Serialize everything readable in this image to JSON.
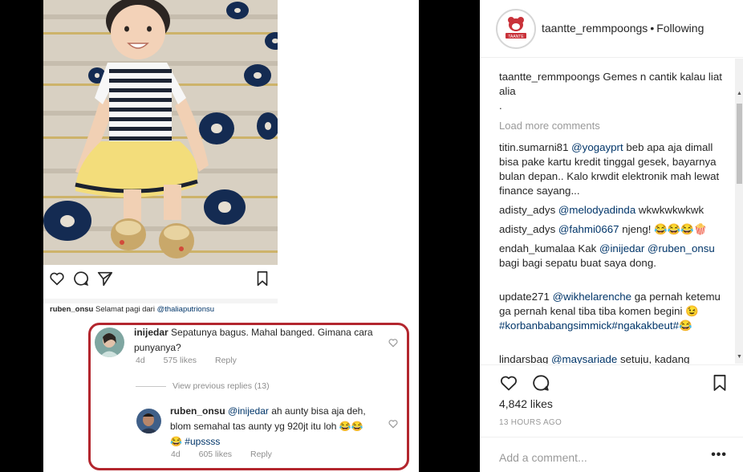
{
  "post": {
    "username": "taantte_remmpoongs",
    "separator": "•",
    "follow_status": "Following",
    "caption": "Gemes n cantik kalau liat alia",
    "caption_extra": ".",
    "load_more": "Load more comments",
    "likes": "4,842 likes",
    "time": "13 HOURS AGO",
    "add_comment_placeholder": "Add a comment...",
    "more_glyph": "•••",
    "avatar_badge": "TAANTE"
  },
  "comments": [
    {
      "user": "titin.sumarni81",
      "mention": "@yogayprt",
      "text": "beb apa aja dimall bisa pake kartu kredit tinggal gesek, bayarnya bulan depan.. Kalo krwdit elektronik mah lewat finance sayang..."
    },
    {
      "user": "adisty_adys",
      "mention": "@melodyadinda",
      "text": "wkwkwkwkwk"
    },
    {
      "user": "adisty_adys",
      "mention": "@fahmi0667",
      "text": "njeng! 😂😂😂🍿"
    },
    {
      "user": "endah_kumalaa",
      "pre": "Kak",
      "mention": "@inijedar",
      "mention2": "@ruben_onsu",
      "text": "bagi bagi sepatu buat saya dong."
    },
    {
      "user": "update271",
      "mention": "@wikhelarenche",
      "text": "ga pernah ketemu ga pernah kenal tiba tiba komen begini 😉",
      "hashtags": "#korbanbabangsimmick#ngakakbeut#😂"
    },
    {
      "user": "lindarsbag",
      "mention": "@maysariade",
      "text": "setuju, kadang"
    }
  ],
  "screenshot": {
    "top_line_user": "ruben_onsu",
    "top_line_text": "Selamat pagi dari",
    "top_line_mention": "@thaliaputrionsu",
    "reply1": {
      "user": "inijedar",
      "text": "Sepatunya bagus. Mahal banged. Gimana cara punyanya?",
      "age": "4d",
      "likes": "575 likes",
      "reply_label": "Reply"
    },
    "view_previous": "View previous replies (13)",
    "reply2": {
      "user": "ruben_onsu",
      "mention": "@inijedar",
      "text": "ah aunty bisa aja deh, blom semahal tas aunty yg 920jt itu loh 😂😂😂",
      "hashtag": "#upssss",
      "age": "4d",
      "likes": "605 likes",
      "reply_label": "Reply"
    }
  },
  "colors": {
    "accent_red": "#b3262e",
    "link": "#003569",
    "muted": "#8e8e8e",
    "text": "#262626"
  }
}
